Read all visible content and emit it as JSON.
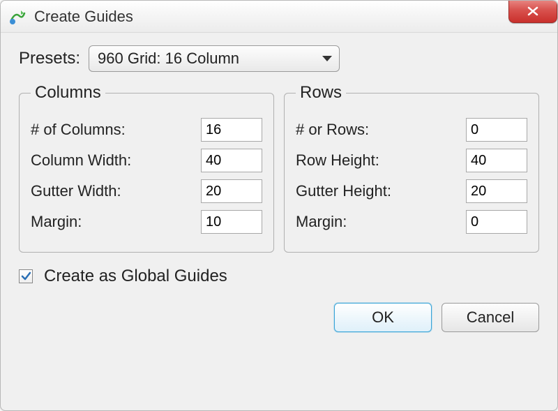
{
  "window": {
    "title": "Create Guides"
  },
  "presets": {
    "label": "Presets:",
    "selected": "960 Grid: 16 Column"
  },
  "columns": {
    "legend": "Columns",
    "num_label": "# of Columns:",
    "num_value": "16",
    "width_label": "Column Width:",
    "width_value": "40",
    "gutter_label": "Gutter Width:",
    "gutter_value": "20",
    "margin_label": "Margin:",
    "margin_value": "10"
  },
  "rows": {
    "legend": "Rows",
    "num_label": "# or Rows:",
    "num_value": "0",
    "height_label": "Row Height:",
    "height_value": "40",
    "gutter_label": "Gutter Height:",
    "gutter_value": "20",
    "margin_label": "Margin:",
    "margin_value": "0"
  },
  "checkbox": {
    "label": "Create as Global Guides",
    "checked": true
  },
  "buttons": {
    "ok": "OK",
    "cancel": "Cancel"
  }
}
